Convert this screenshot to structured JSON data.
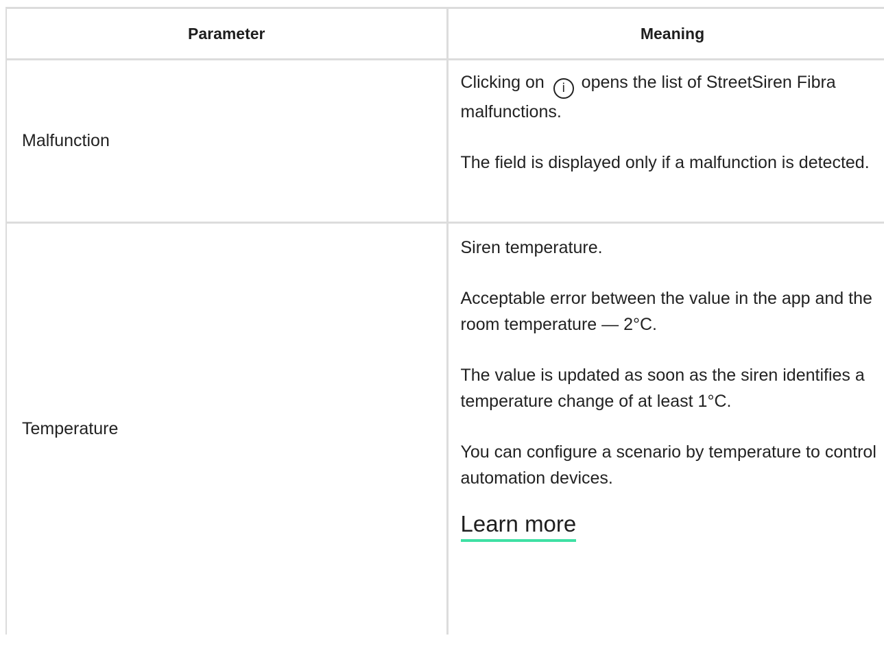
{
  "table": {
    "headers": [
      "Parameter",
      "Meaning"
    ],
    "rows": [
      {
        "parameter": "Malfunction",
        "meaning": {
          "before_icon": "Clicking on",
          "icon": "info-icon",
          "icon_glyph": "i",
          "after_icon": "opens the list of StreetSiren Fibra malfunctions.",
          "paragraph2": "The field is displayed only if a malfunction is detected."
        }
      },
      {
        "parameter": "Temperature",
        "meaning": {
          "paragraphs": [
            "Siren temperature.",
            "Acceptable error between the value in the app and the room temperature — 2°C.",
            "The value is updated as soon as the siren identifies a temperature change of at least 1°C.",
            "You can configure a scenario by temperature to control automation devices."
          ],
          "link_text": "Learn more"
        }
      }
    ]
  },
  "colors": {
    "border": "#dcdcdc",
    "text": "#222222",
    "link_underline": "#3fe0a4"
  }
}
